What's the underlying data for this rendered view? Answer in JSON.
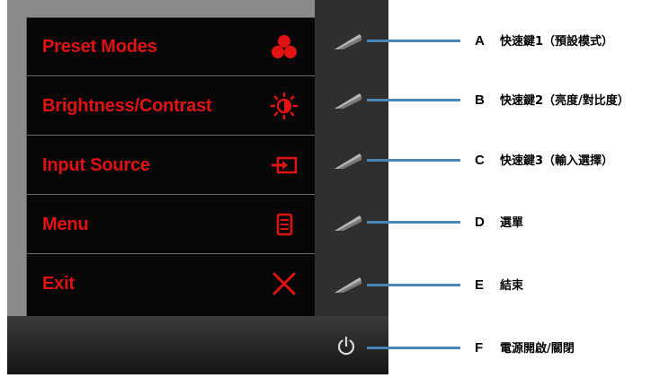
{
  "osd_menu": {
    "items": [
      {
        "label": "Preset Modes",
        "icon": "preset-modes-icon"
      },
      {
        "label": "Brightness/Contrast",
        "icon": "brightness-contrast-icon"
      },
      {
        "label": "Input Source",
        "icon": "input-source-icon"
      },
      {
        "label": "Menu",
        "icon": "menu-icon"
      },
      {
        "label": "Exit",
        "icon": "exit-icon"
      }
    ],
    "accent_color": "#e01212"
  },
  "callouts": [
    {
      "letter": "A",
      "text": "快速鍵1（預設模式）"
    },
    {
      "letter": "B",
      "text": "快速鍵2（亮度/對比度）"
    },
    {
      "letter": "C",
      "text": "快速鍵3（輸入選擇）"
    },
    {
      "letter": "D",
      "text": "選單"
    },
    {
      "letter": "E",
      "text": "結束"
    },
    {
      "letter": "F",
      "text": "電源開啟/關閉"
    }
  ],
  "line_color": "#4b86b8"
}
